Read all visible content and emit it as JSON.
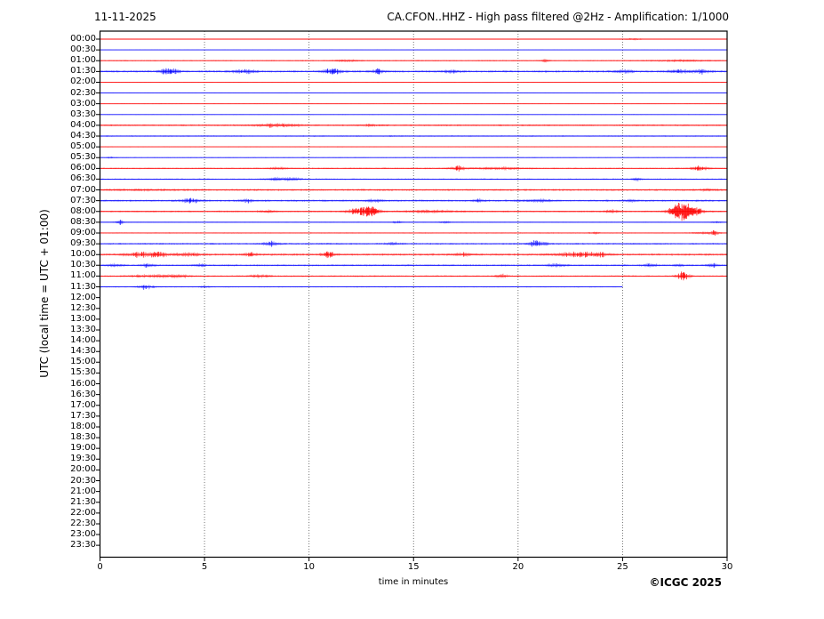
{
  "header": {
    "date": "11-11-2025",
    "title": "CA.CFON..HHZ - High pass filtered @2Hz - Amplification: 1/1000"
  },
  "axes": {
    "y_label": "UTC (local time = UTC + 01:00)",
    "x_label": "time in minutes",
    "x_ticks": [
      "0",
      "5",
      "10",
      "15",
      "20",
      "25",
      "30"
    ],
    "x_range": [
      0,
      30
    ],
    "grid_minutes": [
      5,
      10,
      15,
      20,
      25
    ]
  },
  "footer": {
    "copyright": "©ICGC 2025"
  },
  "colors": {
    "trace_red": "#ff0000",
    "trace_blue": "#0000ff",
    "axis": "#000000",
    "grid": "#555555",
    "background": "#ffffff"
  },
  "chart_data": {
    "type": "line",
    "subtype": "helicorder-dayplot",
    "title": "CA.CFON..HHZ - High pass filtered @2Hz - Amplification: 1/1000",
    "xlabel": "time in minutes",
    "ylabel": "UTC (local time = UTC + 01:00)",
    "xlim": [
      0,
      30
    ],
    "minutes_per_row": 30,
    "rows": [
      {
        "time": "00:00",
        "color": "red",
        "end": 30,
        "base": 0.45,
        "bursts": [
          [
            25.5,
            0.3,
            0.8
          ]
        ]
      },
      {
        "time": "00:30",
        "color": "blue",
        "end": 30,
        "base": 0.32,
        "bursts": []
      },
      {
        "time": "01:00",
        "color": "red",
        "end": 30,
        "base": 0.7,
        "bursts": [
          [
            11.8,
            0.4,
            1.1
          ],
          [
            21.3,
            0.15,
            1.7
          ],
          [
            27.8,
            1.0,
            0.9
          ]
        ]
      },
      {
        "time": "01:30",
        "color": "blue",
        "end": 30,
        "base": 1.2,
        "bursts": [
          [
            3.1,
            0.22,
            2.1
          ],
          [
            3.6,
            0.18,
            1.7
          ],
          [
            6.9,
            0.45,
            1.5
          ],
          [
            11.2,
            0.35,
            2.3
          ],
          [
            13.3,
            0.25,
            1.7
          ],
          [
            16.8,
            0.3,
            1.3
          ],
          [
            25.0,
            0.35,
            1.3
          ],
          [
            27.7,
            0.35,
            1.7
          ],
          [
            28.8,
            0.3,
            1.5
          ]
        ]
      },
      {
        "time": "02:00",
        "color": "red",
        "end": 30,
        "base": 0.4,
        "bursts": []
      },
      {
        "time": "02:30",
        "color": "blue",
        "end": 30,
        "base": 0.3,
        "bursts": []
      },
      {
        "time": "03:00",
        "color": "red",
        "end": 30,
        "base": 0.38,
        "bursts": []
      },
      {
        "time": "03:30",
        "color": "blue",
        "end": 30,
        "base": 0.4,
        "bursts": []
      },
      {
        "time": "04:00",
        "color": "red",
        "end": 30,
        "base": 0.95,
        "bursts": [
          [
            8.5,
            0.8,
            1.5
          ],
          [
            13.0,
            0.4,
            0.7
          ]
        ]
      },
      {
        "time": "04:30",
        "color": "blue",
        "end": 30,
        "base": 0.75,
        "bursts": []
      },
      {
        "time": "05:00",
        "color": "red",
        "end": 30,
        "base": 0.5,
        "bursts": []
      },
      {
        "time": "05:30",
        "color": "blue",
        "end": 30,
        "base": 0.5,
        "bursts": [
          [
            0.5,
            0.15,
            0.7
          ]
        ]
      },
      {
        "time": "06:00",
        "color": "red",
        "end": 30,
        "base": 0.8,
        "bursts": [
          [
            8.5,
            0.35,
            0.9
          ],
          [
            17.1,
            0.25,
            2.0
          ],
          [
            19.0,
            1.0,
            1.1
          ],
          [
            28.7,
            0.3,
            2.1
          ]
        ]
      },
      {
        "time": "06:30",
        "color": "blue",
        "end": 30,
        "base": 0.8,
        "bursts": [
          [
            8.8,
            0.55,
            1.7
          ],
          [
            25.7,
            0.18,
            1.4
          ]
        ]
      },
      {
        "time": "07:00",
        "color": "red",
        "end": 30,
        "base": 1.15,
        "bursts": [
          [
            2.0,
            1.5,
            0.5
          ],
          [
            29.0,
            0.3,
            0.9
          ]
        ]
      },
      {
        "time": "07:30",
        "color": "blue",
        "end": 30,
        "base": 1.15,
        "bursts": [
          [
            4.3,
            0.35,
            1.9
          ],
          [
            7.0,
            0.28,
            1.5
          ],
          [
            13.1,
            0.25,
            1.4
          ],
          [
            18.1,
            0.2,
            1.2
          ],
          [
            21.0,
            0.45,
            1.3
          ],
          [
            25.4,
            0.2,
            1.3
          ]
        ]
      },
      {
        "time": "08:00",
        "color": "red",
        "end": 30,
        "base": 0.9,
        "bursts": [
          [
            8.0,
            0.3,
            1.4
          ],
          [
            12.6,
            0.5,
            3.0
          ],
          [
            13.0,
            0.25,
            2.3
          ],
          [
            15.9,
            0.8,
            1.3
          ],
          [
            24.5,
            0.25,
            1.4
          ],
          [
            27.8,
            0.4,
            7.5
          ],
          [
            28.5,
            0.35,
            2.2
          ]
        ]
      },
      {
        "time": "08:30",
        "color": "blue",
        "end": 30,
        "base": 0.5,
        "bursts": [
          [
            0.95,
            0.13,
            2.1
          ],
          [
            14.2,
            0.18,
            1.1
          ],
          [
            16.5,
            0.22,
            0.9
          ],
          [
            29.5,
            0.18,
            0.9
          ]
        ]
      },
      {
        "time": "09:00",
        "color": "red",
        "end": 30,
        "base": 0.65,
        "bursts": [
          [
            23.7,
            0.15,
            0.8
          ],
          [
            29.0,
            0.45,
            1.1
          ],
          [
            29.4,
            0.12,
            1.9
          ]
        ]
      },
      {
        "time": "09:30",
        "color": "blue",
        "end": 30,
        "base": 1.0,
        "bursts": [
          [
            8.2,
            0.28,
            1.7
          ],
          [
            14.0,
            0.25,
            1.1
          ],
          [
            20.8,
            0.22,
            2.5
          ],
          [
            21.3,
            0.13,
            1.6
          ]
        ]
      },
      {
        "time": "10:00",
        "color": "red",
        "end": 30,
        "base": 1.25,
        "bursts": [
          [
            1.8,
            0.45,
            1.7
          ],
          [
            2.8,
            0.35,
            1.9
          ],
          [
            4.2,
            0.45,
            1.5
          ],
          [
            7.2,
            0.22,
            1.7
          ],
          [
            10.9,
            0.22,
            2.5
          ],
          [
            17.4,
            0.3,
            1.4
          ],
          [
            22.6,
            0.7,
            1.5
          ],
          [
            23.8,
            0.45,
            1.4
          ]
        ]
      },
      {
        "time": "10:30",
        "color": "blue",
        "end": 30,
        "base": 1.0,
        "bursts": [
          [
            0.8,
            0.28,
            1.3
          ],
          [
            2.3,
            0.22,
            1.5
          ],
          [
            4.8,
            0.18,
            1.2
          ],
          [
            21.8,
            0.35,
            1.3
          ],
          [
            26.3,
            0.25,
            1.6
          ],
          [
            27.7,
            0.18,
            1.0
          ],
          [
            29.3,
            0.25,
            1.4
          ]
        ]
      },
      {
        "time": "11:00",
        "color": "red",
        "end": 30,
        "base": 0.9,
        "bursts": [
          [
            2.5,
            0.7,
            1.3
          ],
          [
            3.8,
            0.35,
            1.4
          ],
          [
            7.7,
            0.35,
            1.4
          ],
          [
            19.2,
            0.18,
            1.8
          ],
          [
            27.9,
            0.22,
            3.4
          ]
        ]
      },
      {
        "time": "11:30",
        "color": "blue",
        "end": 25,
        "base": 0.7,
        "bursts": [
          [
            2.2,
            0.3,
            1.9
          ],
          [
            5.0,
            0.18,
            0.9
          ]
        ]
      },
      {
        "time": "12:00",
        "color": "red",
        "end": 0,
        "base": 0,
        "bursts": []
      },
      {
        "time": "12:30",
        "color": "blue",
        "end": 0,
        "base": 0,
        "bursts": []
      },
      {
        "time": "13:00",
        "color": "red",
        "end": 0,
        "base": 0,
        "bursts": []
      },
      {
        "time": "13:30",
        "color": "blue",
        "end": 0,
        "base": 0,
        "bursts": []
      },
      {
        "time": "14:00",
        "color": "red",
        "end": 0,
        "base": 0,
        "bursts": []
      },
      {
        "time": "14:30",
        "color": "blue",
        "end": 0,
        "base": 0,
        "bursts": []
      },
      {
        "time": "15:00",
        "color": "red",
        "end": 0,
        "base": 0,
        "bursts": []
      },
      {
        "time": "15:30",
        "color": "blue",
        "end": 0,
        "base": 0,
        "bursts": []
      },
      {
        "time": "16:00",
        "color": "red",
        "end": 0,
        "base": 0,
        "bursts": []
      },
      {
        "time": "16:30",
        "color": "blue",
        "end": 0,
        "base": 0,
        "bursts": []
      },
      {
        "time": "17:00",
        "color": "red",
        "end": 0,
        "base": 0,
        "bursts": []
      },
      {
        "time": "17:30",
        "color": "blue",
        "end": 0,
        "base": 0,
        "bursts": []
      },
      {
        "time": "18:00",
        "color": "red",
        "end": 0,
        "base": 0,
        "bursts": []
      },
      {
        "time": "18:30",
        "color": "blue",
        "end": 0,
        "base": 0,
        "bursts": []
      },
      {
        "time": "19:00",
        "color": "red",
        "end": 0,
        "base": 0,
        "bursts": []
      },
      {
        "time": "19:30",
        "color": "blue",
        "end": 0,
        "base": 0,
        "bursts": []
      },
      {
        "time": "20:00",
        "color": "red",
        "end": 0,
        "base": 0,
        "bursts": []
      },
      {
        "time": "20:30",
        "color": "blue",
        "end": 0,
        "base": 0,
        "bursts": []
      },
      {
        "time": "21:00",
        "color": "red",
        "end": 0,
        "base": 0,
        "bursts": []
      },
      {
        "time": "21:30",
        "color": "blue",
        "end": 0,
        "base": 0,
        "bursts": []
      },
      {
        "time": "22:00",
        "color": "red",
        "end": 0,
        "base": 0,
        "bursts": []
      },
      {
        "time": "22:30",
        "color": "blue",
        "end": 0,
        "base": 0,
        "bursts": []
      },
      {
        "time": "23:00",
        "color": "red",
        "end": 0,
        "base": 0,
        "bursts": []
      },
      {
        "time": "23:30",
        "color": "blue",
        "end": 0,
        "base": 0,
        "bursts": []
      }
    ]
  }
}
